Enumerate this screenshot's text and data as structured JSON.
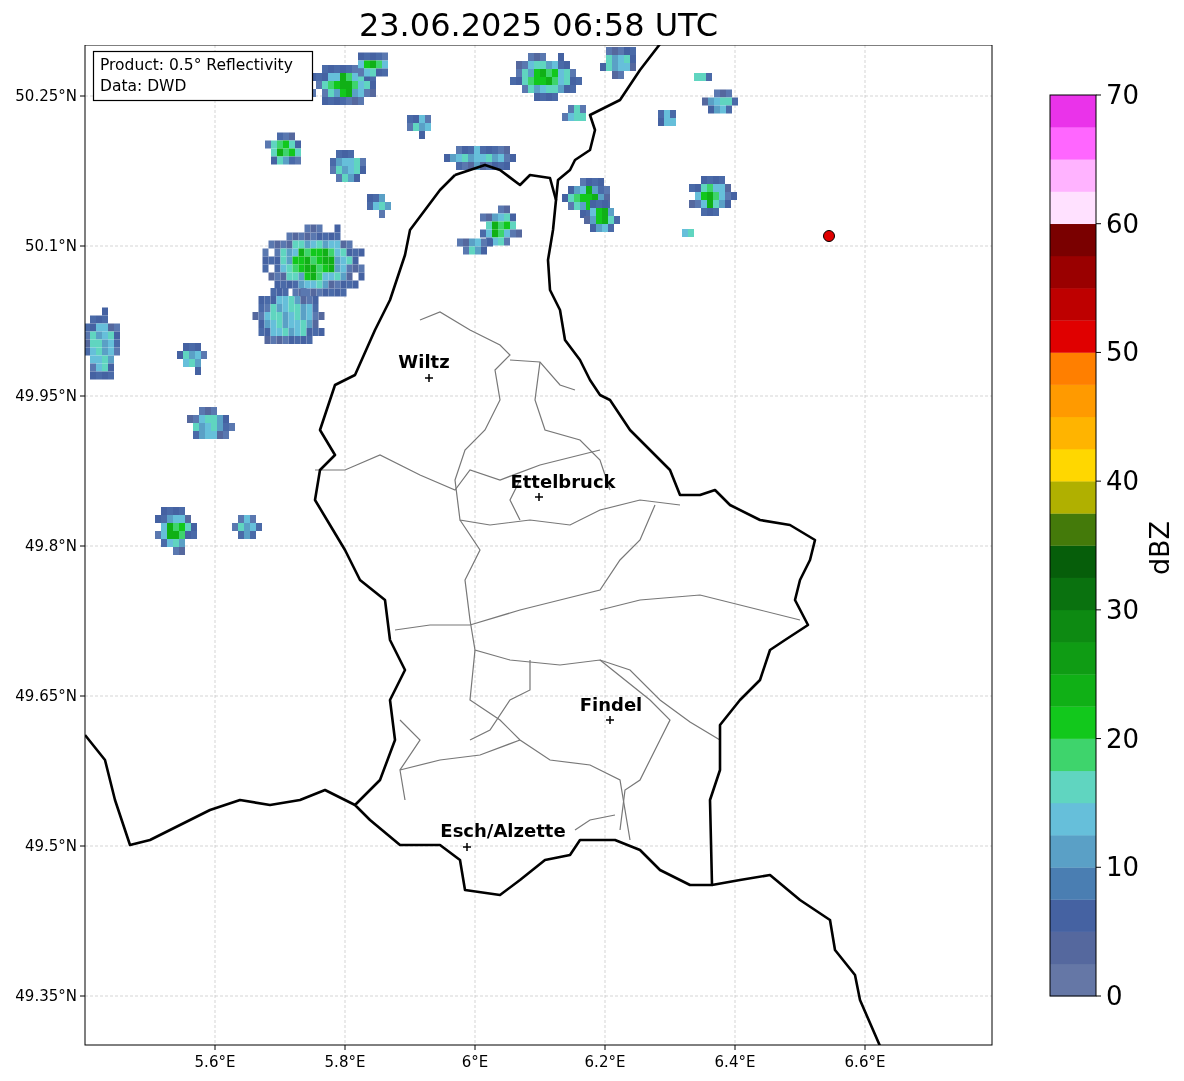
{
  "title": "23.06.2025 06:58 UTC",
  "info_box": {
    "lines": [
      "Product: 0.5° Reflectivity",
      "Data: DWD"
    ]
  },
  "map": {
    "y_ticks": [
      "50.25°N",
      "50.1°N",
      "49.95°N",
      "49.8°N",
      "49.65°N",
      "49.5°N",
      "49.35°N"
    ],
    "x_ticks": [
      "5.6°E",
      "5.8°E",
      "6°E",
      "6.2°E",
      "6.4°E",
      "6.6°E"
    ],
    "cities": [
      {
        "name": "Wiltz"
      },
      {
        "name": "Ettelbruck"
      },
      {
        "name": "Findel"
      },
      {
        "name": "Esch/Alzette"
      }
    ]
  },
  "colorbar": {
    "label": "dBZ",
    "ticks": [
      "70",
      "60",
      "50",
      "40",
      "30",
      "20",
      "10",
      "0"
    ],
    "bands": [
      {
        "color": "#6577a6"
      },
      {
        "color": "#55689e"
      },
      {
        "color": "#4562a2"
      },
      {
        "color": "#4a7eb2"
      },
      {
        "color": "#5aa0c6"
      },
      {
        "color": "#66bfda"
      },
      {
        "color": "#60d5c0"
      },
      {
        "color": "#3ed46c"
      },
      {
        "color": "#12c81c"
      },
      {
        "color": "#10b016"
      },
      {
        "color": "#0f9c14"
      },
      {
        "color": "#0d8a12"
      },
      {
        "color": "#0a720f"
      },
      {
        "color": "#065e0a"
      },
      {
        "color": "#447a0a"
      },
      {
        "color": "#b0b000"
      },
      {
        "color": "#ffd700"
      },
      {
        "color": "#ffb400"
      },
      {
        "color": "#ff9a00"
      },
      {
        "color": "#ff7f00"
      },
      {
        "color": "#e00000"
      },
      {
        "color": "#be0000"
      },
      {
        "color": "#9a0000"
      },
      {
        "color": "#7a0000"
      },
      {
        "color": "#ffe1ff"
      },
      {
        "color": "#ffb3ff"
      },
      {
        "color": "#ff66ff"
      },
      {
        "color": "#ea33ea"
      }
    ]
  }
}
